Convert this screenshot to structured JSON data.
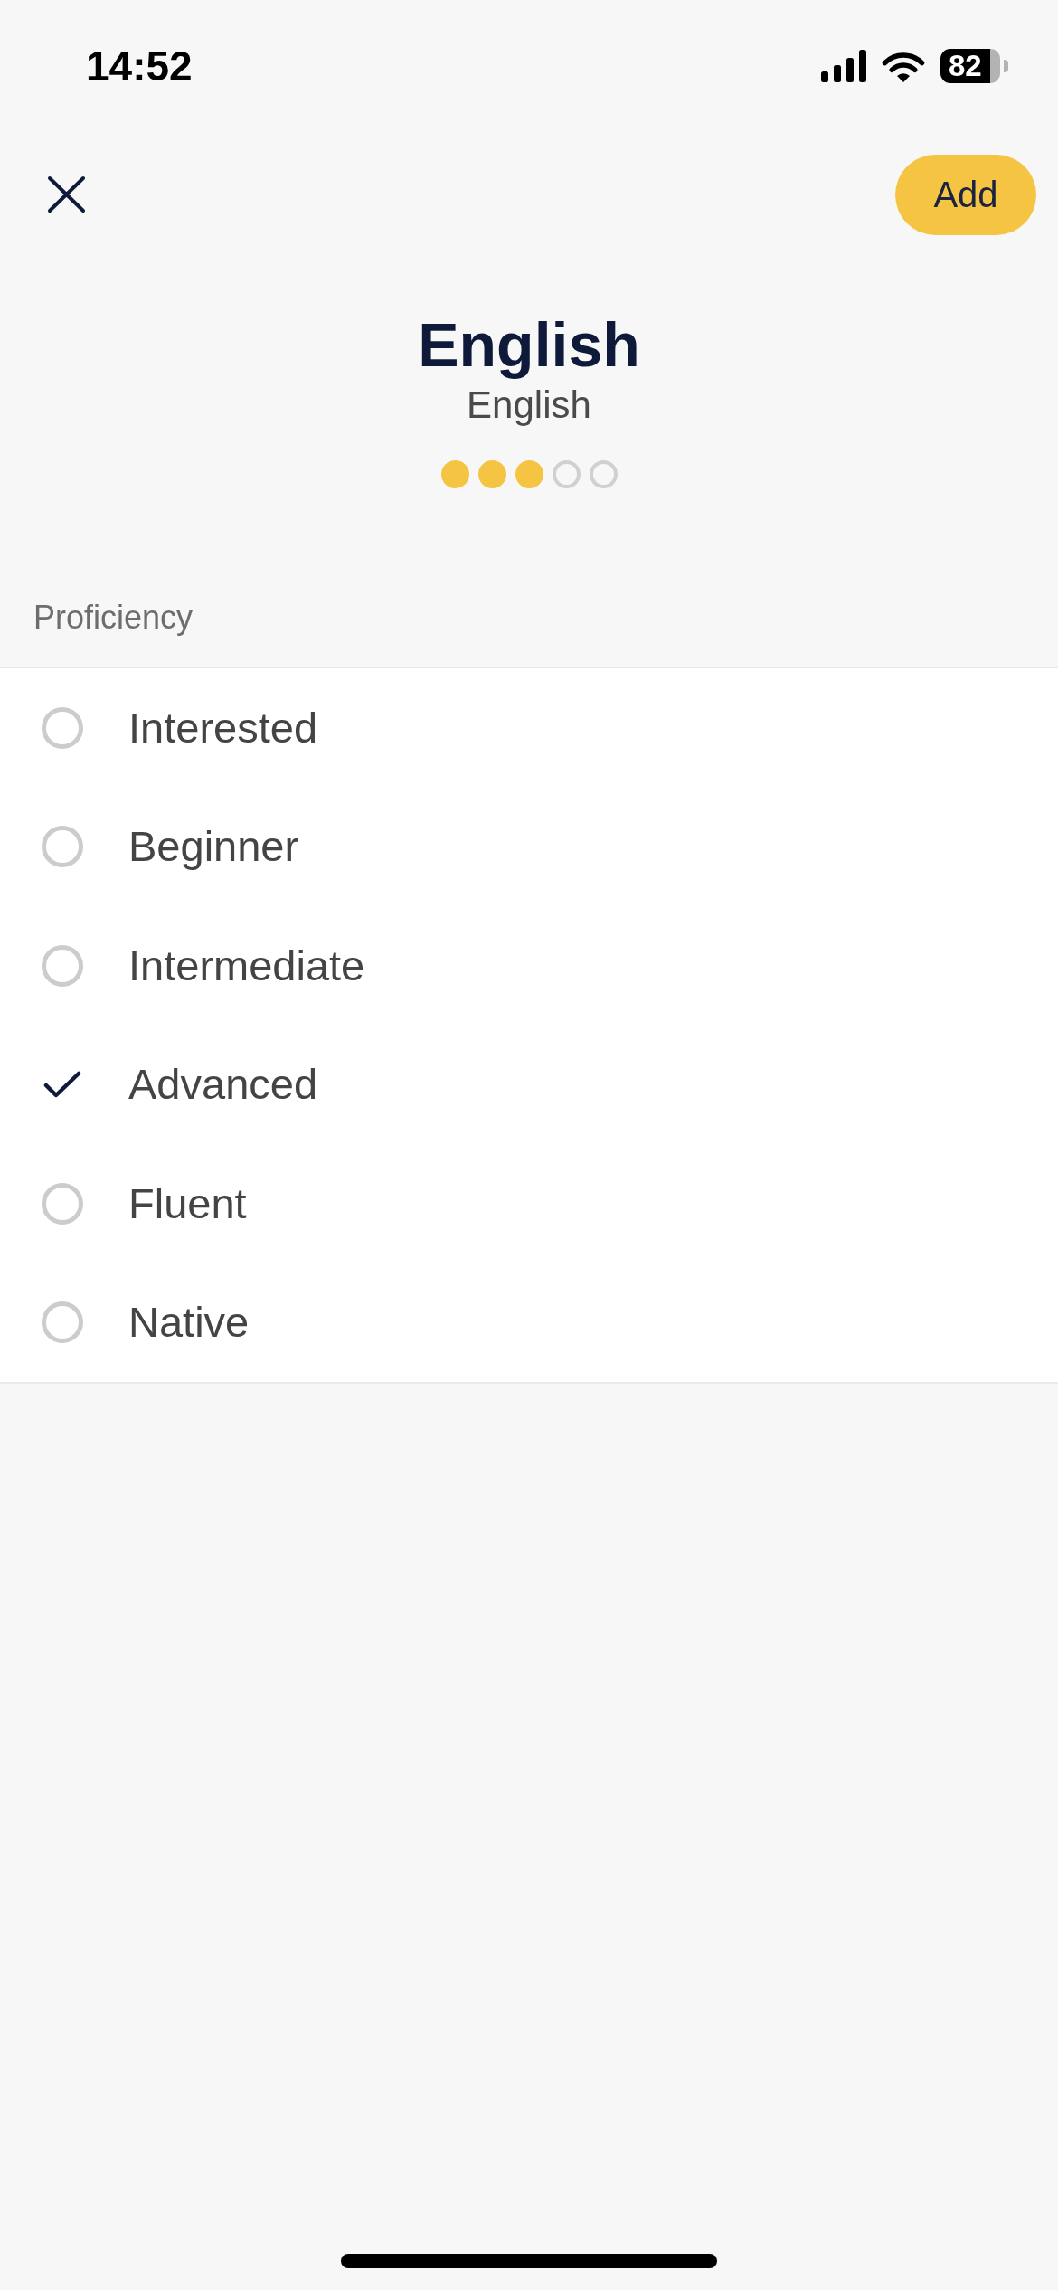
{
  "status_bar": {
    "time": "14:52",
    "battery": "82"
  },
  "nav_bar": {
    "add_button": "Add"
  },
  "language": {
    "name": "English",
    "native_name": "English",
    "level_dots": [
      {
        "filled": true
      },
      {
        "filled": true
      },
      {
        "filled": true
      },
      {
        "filled": false
      },
      {
        "filled": false
      }
    ]
  },
  "section_title": "Proficiency",
  "options": [
    {
      "label": "Interested",
      "selected": false
    },
    {
      "label": "Beginner",
      "selected": false
    },
    {
      "label": "Intermediate",
      "selected": false
    },
    {
      "label": "Advanced",
      "selected": true
    },
    {
      "label": "Fluent",
      "selected": false
    },
    {
      "label": "Native",
      "selected": false
    }
  ]
}
